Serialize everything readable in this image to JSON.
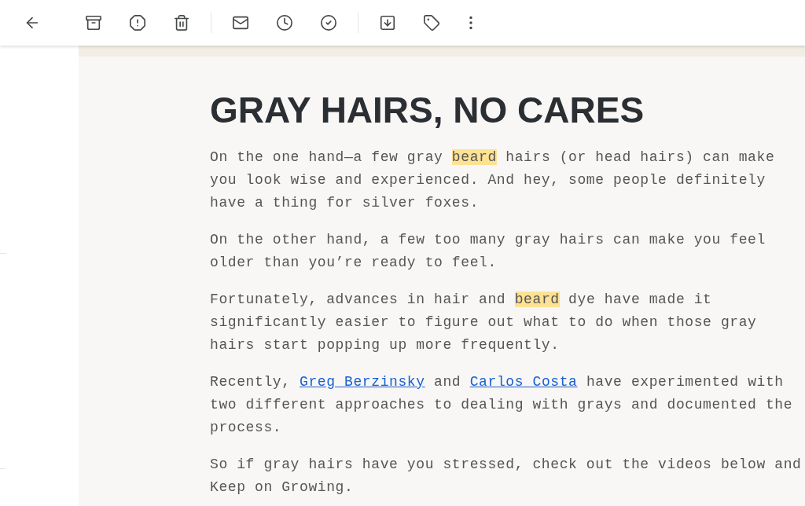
{
  "email": {
    "heading": "GRAY HAIRS, NO CARES",
    "paragraphs": [
      {
        "segments": [
          {
            "kind": "plain",
            "text": "On the one hand—a few gray "
          },
          {
            "kind": "highlight",
            "text": "beard"
          },
          {
            "kind": "plain",
            "text": " hairs (or head hairs) can make you look wise and experienced. And hey, some people definitely have a thing for silver foxes."
          }
        ]
      },
      {
        "segments": [
          {
            "kind": "plain",
            "text": "On the other hand, a few too many gray hairs can make you feel older than you’re ready to feel."
          }
        ]
      },
      {
        "segments": [
          {
            "kind": "plain",
            "text": "Fortunately, advances in hair and "
          },
          {
            "kind": "highlight",
            "text": "beard"
          },
          {
            "kind": "plain",
            "text": " dye have made it significantly easier to figure out what to do when those gray hairs start popping up more frequently."
          }
        ]
      },
      {
        "segments": [
          {
            "kind": "plain",
            "text": "Recently, "
          },
          {
            "kind": "link",
            "text": "Greg Berzinsky"
          },
          {
            "kind": "plain",
            "text": " and "
          },
          {
            "kind": "link",
            "text": "Carlos Costa"
          },
          {
            "kind": "plain",
            "text": " have experimented with two different approaches to dealing with grays and documented the process."
          }
        ]
      },
      {
        "segments": [
          {
            "kind": "plain",
            "text": "So if gray hairs have you stressed, check out the videos below and Keep on Growing."
          }
        ]
      }
    ]
  }
}
